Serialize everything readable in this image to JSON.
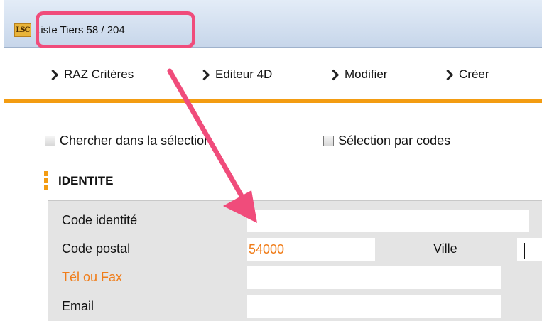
{
  "window": {
    "logo_text": "LSC",
    "title": "Liste Tiers 58 / 204"
  },
  "toolbar": {
    "buttons": [
      {
        "label": "RAZ Critères"
      },
      {
        "label": "Editeur 4D"
      },
      {
        "label": "Modifier"
      },
      {
        "label": "Créer"
      }
    ]
  },
  "options": {
    "search_in_selection": {
      "label": "Chercher dans la sélection",
      "checked": false
    },
    "select_by_codes": {
      "label": "Sélection par codes",
      "checked": false
    }
  },
  "section": {
    "title": "IDENTITE"
  },
  "form": {
    "code_identite": {
      "label": "Code identité",
      "value": ""
    },
    "code_postal": {
      "label": "Code postal",
      "value": "54000"
    },
    "ville": {
      "label": "Ville",
      "value": ""
    },
    "tel_fax": {
      "label": "Tél ou Fax",
      "value": ""
    },
    "email": {
      "label": "Email",
      "value": ""
    }
  },
  "colors": {
    "accent": "#f39c12",
    "highlight": "#f04c7b",
    "link_label": "#f07d1a"
  }
}
